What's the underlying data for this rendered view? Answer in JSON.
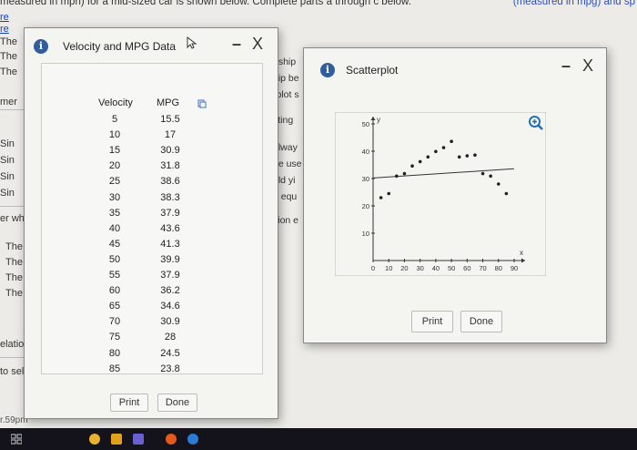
{
  "background": {
    "top_text": "measured in mph) for a mid-sized car is shown below. Complete parts a through c below.",
    "top_right": "(measured in mpg) and sp",
    "left_fragments": [
      "The",
      "The",
      "The",
      "mer",
      "Sin",
      "Sin",
      "Sin",
      "Sin",
      "er wh",
      "The",
      "The",
      "The",
      "The",
      "elatio",
      "to sel"
    ],
    "links": [
      "re",
      "re"
    ],
    "right_fragments": [
      "nship",
      "hip be",
      "rplot s",
      "cting",
      "alway",
      "be use",
      "uld yi",
      "h equ",
      "sion e"
    ],
    "bottom_fragment": "r.59pm"
  },
  "data_dialog": {
    "title": "Velocity and MPG Data",
    "headers": {
      "velocity": "Velocity",
      "mpg": "MPG"
    },
    "rows": [
      {
        "velocity": "5",
        "mpg": "15.5"
      },
      {
        "velocity": "10",
        "mpg": "17"
      },
      {
        "velocity": "15",
        "mpg": "30.9"
      },
      {
        "velocity": "20",
        "mpg": "31.8"
      },
      {
        "velocity": "25",
        "mpg": "38.6"
      },
      {
        "velocity": "30",
        "mpg": "38.3"
      },
      {
        "velocity": "35",
        "mpg": "37.9"
      },
      {
        "velocity": "40",
        "mpg": "43.6"
      },
      {
        "velocity": "45",
        "mpg": "41.3"
      },
      {
        "velocity": "50",
        "mpg": "39.9"
      },
      {
        "velocity": "55",
        "mpg": "37.9"
      },
      {
        "velocity": "60",
        "mpg": "36.2"
      },
      {
        "velocity": "65",
        "mpg": "34.6"
      },
      {
        "velocity": "70",
        "mpg": "30.9"
      },
      {
        "velocity": "75",
        "mpg": "28"
      },
      {
        "velocity": "80",
        "mpg": "24.5"
      },
      {
        "velocity": "85",
        "mpg": "23.8"
      }
    ],
    "print_label": "Print",
    "done_label": "Done",
    "minimize_glyph": "–",
    "close_glyph": "X",
    "info_glyph": "i"
  },
  "scatter_dialog": {
    "title": "Scatterplot",
    "print_label": "Print",
    "done_label": "Done",
    "minimize_glyph": "–",
    "close_glyph": "X",
    "info_glyph": "i",
    "zoom_icon": "zoom-in-icon"
  },
  "chart_data": {
    "type": "scatter",
    "x_axis_label": "x",
    "y_axis_label": "y",
    "xlim": [
      0,
      90
    ],
    "ylim": [
      0,
      50
    ],
    "x_ticks": [
      "0",
      "10",
      "20",
      "30",
      "40",
      "50",
      "60",
      "70",
      "80",
      "90"
    ],
    "y_ticks": [
      "10",
      "20",
      "30",
      "40",
      "50"
    ],
    "points": [
      [
        5,
        23
      ],
      [
        10,
        24.5
      ],
      [
        15,
        30.9
      ],
      [
        20,
        31.8
      ],
      [
        25,
        34.6
      ],
      [
        30,
        36.2
      ],
      [
        35,
        37.9
      ],
      [
        40,
        39.9
      ],
      [
        45,
        41.3
      ],
      [
        50,
        43.6
      ],
      [
        55,
        37.9
      ],
      [
        60,
        38.3
      ],
      [
        65,
        38.6
      ],
      [
        70,
        31.8
      ],
      [
        75,
        30.9
      ],
      [
        80,
        28
      ],
      [
        85,
        24.5
      ]
    ],
    "regression_line": {
      "y_at_x0": 30.2,
      "y_at_x90": 33.6
    },
    "point_color": "#222222",
    "line_color": "#333333"
  },
  "taskbar": {
    "icons": [
      "task-view-icon",
      "chrome-icon",
      "folder-icon",
      "store-icon",
      "firefox-icon",
      "app-icon"
    ]
  }
}
